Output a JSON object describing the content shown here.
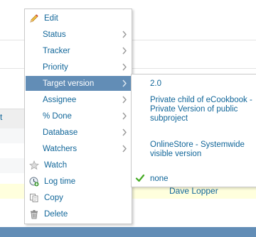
{
  "background": {
    "header_fragment": "t",
    "assignee_name": "Dave Lopper"
  },
  "menu": {
    "items": [
      {
        "label": "Edit",
        "icon": "pencil-icon"
      },
      {
        "label": "Status",
        "submenu": true
      },
      {
        "label": "Tracker",
        "submenu": true
      },
      {
        "label": "Priority",
        "submenu": true
      },
      {
        "label": "Target version",
        "submenu": true,
        "active": true
      },
      {
        "label": "Assignee",
        "submenu": true
      },
      {
        "label": "% Done",
        "submenu": true
      },
      {
        "label": "Database",
        "submenu": true
      },
      {
        "label": "Watchers",
        "submenu": true
      },
      {
        "label": "Watch",
        "icon": "star-icon"
      },
      {
        "label": "Log time",
        "icon": "clock-add-icon"
      },
      {
        "label": "Copy",
        "icon": "copy-icon"
      },
      {
        "label": "Delete",
        "icon": "trash-icon"
      }
    ]
  },
  "submenu": {
    "items": [
      {
        "label": "2.0"
      },
      {
        "label": "Private child of eCookbook - Private Version of public subproject"
      },
      {
        "label": "OnlineStore - Systemwide visible version"
      },
      {
        "label": "none",
        "checked": true
      }
    ]
  },
  "colors": {
    "link": "#116699",
    "active_bg": "#628db6",
    "check": "#44aa22",
    "highlight_row": "#ffffdd"
  }
}
